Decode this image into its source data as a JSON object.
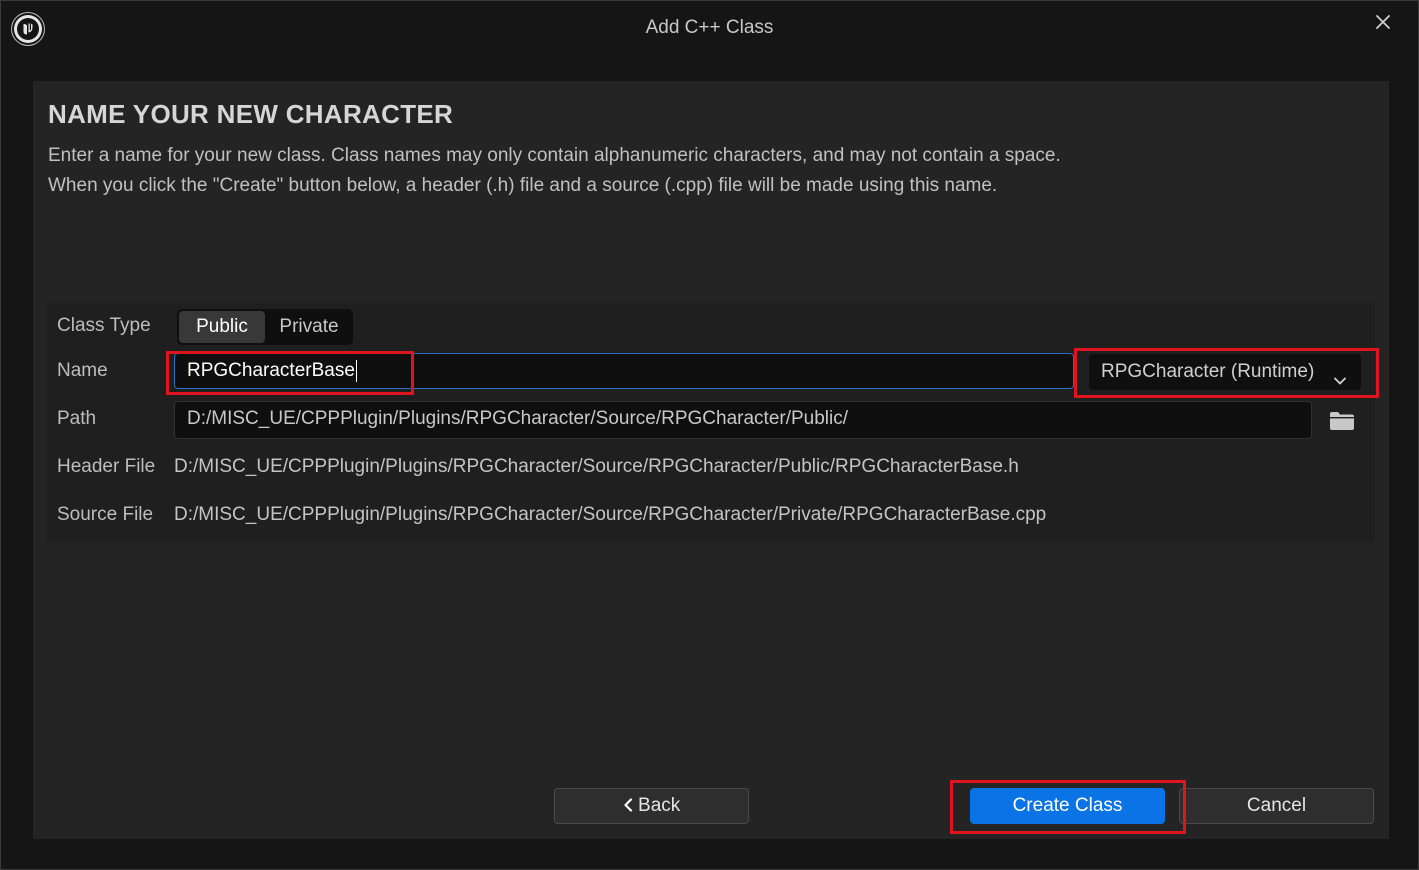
{
  "window": {
    "title": "Add C++ Class"
  },
  "page": {
    "heading": "NAME YOUR NEW CHARACTER",
    "description_line1": "Enter a name for your new class. Class names may only contain alphanumeric characters, and may not contain a space.",
    "description_line2": "When you click the \"Create\" button below, a header (.h) file and a source (.cpp) file will be made using this name."
  },
  "form": {
    "class_type_label": "Class Type",
    "class_type_options": [
      "Public",
      "Private"
    ],
    "class_type_selected": "Public",
    "name_label": "Name",
    "name_value": "RPGCharacterBase",
    "module_selected": "RPGCharacter (Runtime)",
    "path_label": "Path",
    "path_value": "D:/MISC_UE/CPPPlugin/Plugins/RPGCharacter/Source/RPGCharacter/Public/",
    "header_file_label": "Header File",
    "header_file_value": "D:/MISC_UE/CPPPlugin/Plugins/RPGCharacter/Source/RPGCharacter/Public/RPGCharacterBase.h",
    "source_file_label": "Source File",
    "source_file_value": "D:/MISC_UE/CPPPlugin/Plugins/RPGCharacter/Source/RPGCharacter/Private/RPGCharacterBase.cpp"
  },
  "buttons": {
    "back_label": "Back",
    "create_label": "Create Class",
    "cancel_label": "Cancel"
  },
  "icons": {
    "logo": "unreal-logo-icon",
    "close": "close-icon",
    "dropdown": "chevron-down-icon",
    "browse": "folder-icon",
    "back": "chevron-left-icon"
  },
  "colors": {
    "accent": "#0a74e6",
    "highlight": "#e0141f",
    "background": "#242424"
  }
}
